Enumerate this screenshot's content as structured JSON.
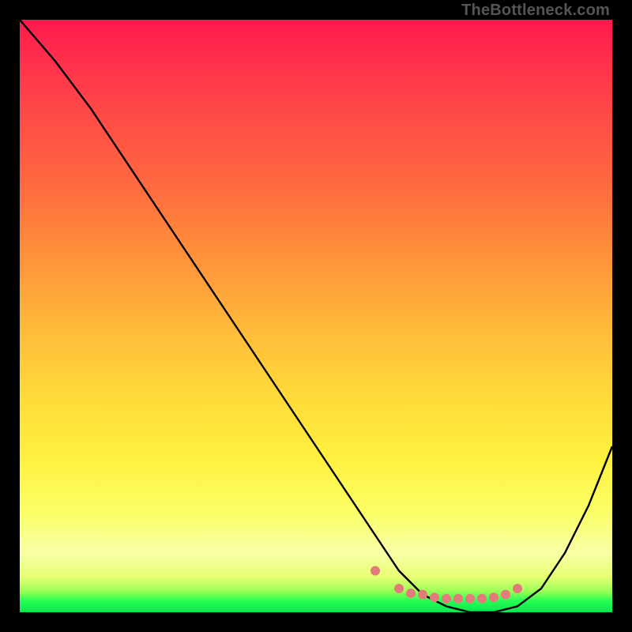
{
  "attribution": "TheBottleneck.com",
  "chart_data": {
    "type": "line",
    "title": "",
    "xlabel": "",
    "ylabel": "",
    "xlim": [
      0,
      100
    ],
    "ylim": [
      0,
      100
    ],
    "x": [
      0,
      6,
      12,
      18,
      24,
      30,
      36,
      42,
      48,
      54,
      60,
      64,
      68,
      72,
      76,
      80,
      84,
      88,
      92,
      96,
      100
    ],
    "values": [
      100,
      93,
      85,
      76,
      67,
      58,
      49,
      40,
      31,
      22,
      13,
      7,
      3,
      1,
      0,
      0,
      1,
      4,
      10,
      18,
      28
    ],
    "markers": {
      "x": [
        60,
        64,
        66,
        68,
        70,
        72,
        74,
        76,
        78,
        80,
        82,
        84
      ],
      "values": [
        7,
        4,
        3.2,
        3,
        2.5,
        2.3,
        2.3,
        2.3,
        2.3,
        2.5,
        3,
        4
      ]
    },
    "marker_color": "#e37b7b",
    "line_color": "#000000"
  }
}
